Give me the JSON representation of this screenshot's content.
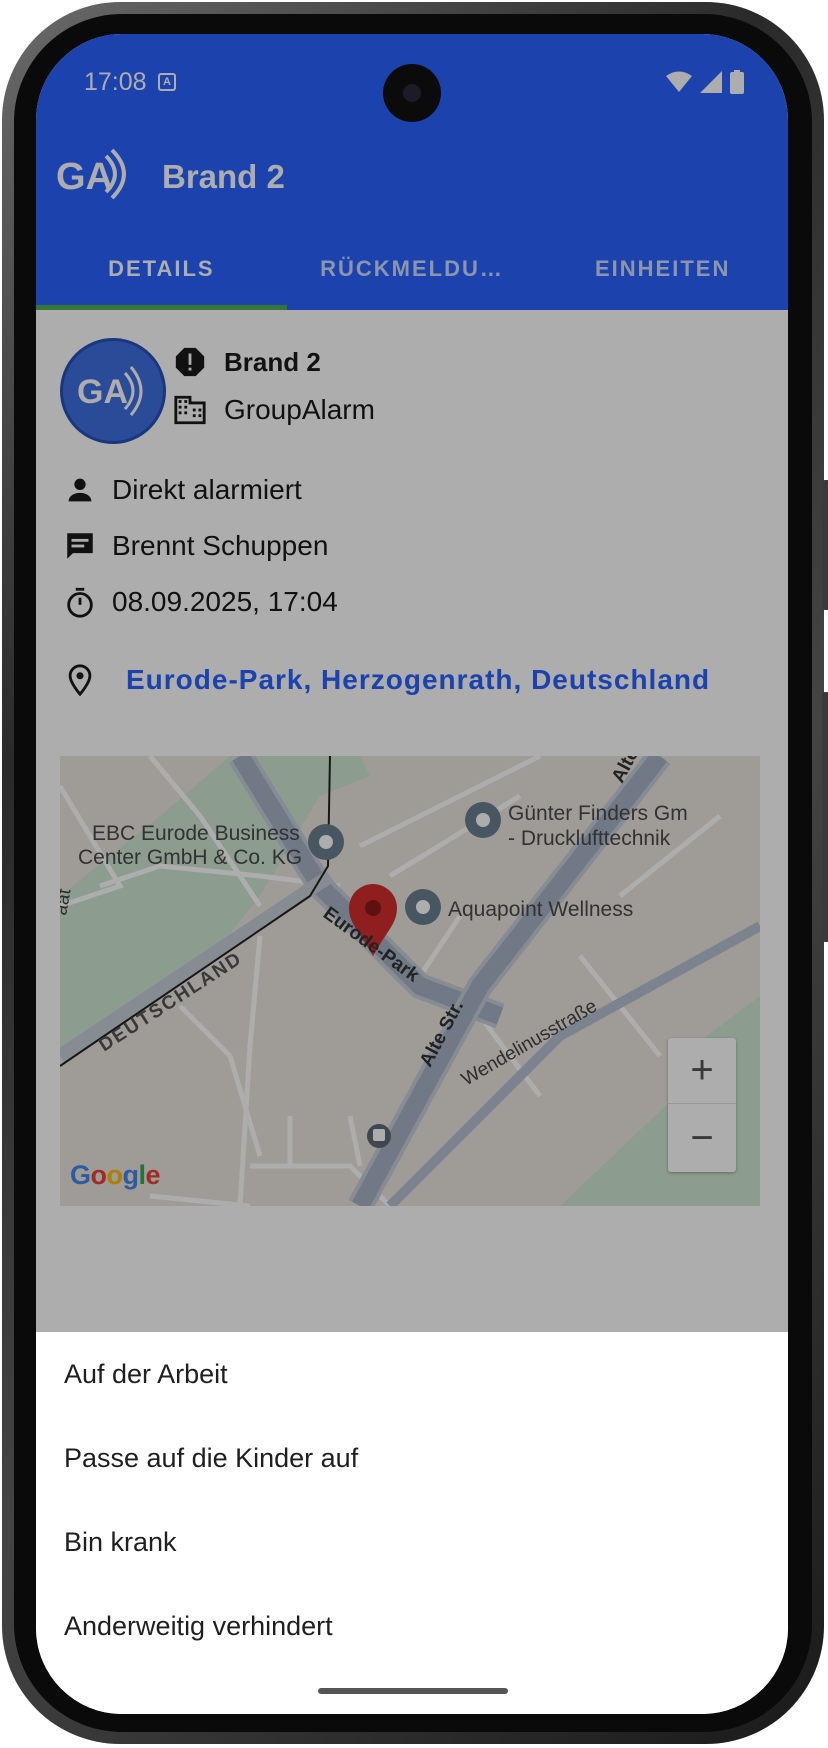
{
  "status_bar": {
    "time": "17:08",
    "badge": "A"
  },
  "app_bar": {
    "title": "Brand 2"
  },
  "tabs": [
    {
      "label": "DETAILS",
      "active": true
    },
    {
      "label": "RÜCKMELDU…",
      "active": false
    },
    {
      "label": "EINHEITEN",
      "active": false
    }
  ],
  "alarm": {
    "title": "Brand 2",
    "organization": "GroupAlarm",
    "alert_type": "Direkt alarmiert",
    "message": "Brennt Schuppen",
    "datetime": "08.09.2025, 17:04",
    "location": "Eurode-Park, Herzogenrath, Deutschland"
  },
  "map": {
    "labels": {
      "ebc": [
        "EBC Eurode Business",
        "Center GmbH & Co. KG"
      ],
      "gunter": [
        "Günter Finders Gm",
        "- Drucklufttechnik"
      ],
      "aquapoint": "Aquapoint Wellness",
      "eurode_park": "Eurode-Park",
      "deutschland": "DEUTSCHLAND",
      "alte_str": "Alte Str.",
      "alte_top": "Alte",
      "wendelinus": "Wendelinusstraße",
      "left_edge": "aat"
    },
    "zoom_in": "+",
    "zoom_out": "−",
    "attribution": "Google"
  },
  "response_options": [
    "Auf der Arbeit",
    "Passe auf die Kinder auf",
    "Bin krank",
    "Anderweitig verhindert"
  ],
  "colors": {
    "primary": "#2962ff",
    "tab_indicator": "#4caf50",
    "link": "#2962ff",
    "pin": "#d32f2f"
  }
}
